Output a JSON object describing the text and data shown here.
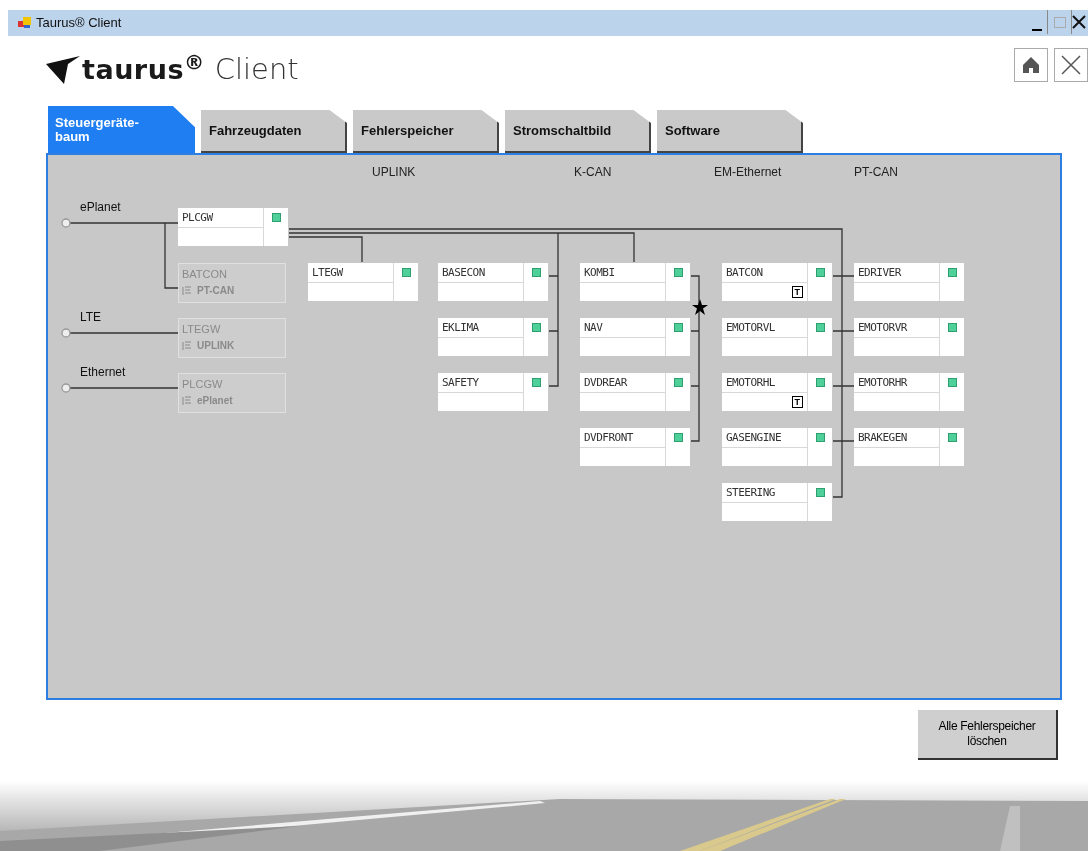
{
  "window": {
    "title": "Taurus® Client"
  },
  "logo": {
    "brand": "taurus$^{®}$",
    "product": "Client"
  },
  "tabs": [
    {
      "label": "Steuergeräte-\nbaum",
      "selected": true
    },
    {
      "label": "Fahrzeugdaten",
      "selected": false
    },
    {
      "label": "Fehlerspeicher",
      "selected": false
    },
    {
      "label": "Stromschaltbild",
      "selected": false
    },
    {
      "label": "Software",
      "selected": false
    }
  ],
  "buses": [
    "UPLINK",
    "K-CAN",
    "EM-Ethernet",
    "PT-CAN"
  ],
  "roots": [
    {
      "label": "ePlanet"
    },
    {
      "label": "LTE"
    },
    {
      "label": "Ethernet"
    }
  ],
  "nodes": [
    {
      "kind": "device",
      "name": "PLCGW",
      "online": true
    },
    {
      "kind": "ghost",
      "name": "BATCON",
      "bus": "PT-CAN"
    },
    {
      "kind": "ghost",
      "name": "LTEGW",
      "bus": "UPLINK"
    },
    {
      "kind": "ghost",
      "name": "PLCGW",
      "bus": "ePlanet"
    },
    {
      "kind": "device",
      "name": "LTEGW",
      "online": true
    },
    {
      "kind": "device",
      "name": "BASECON",
      "online": true
    },
    {
      "kind": "device",
      "name": "EKLIMA",
      "online": true
    },
    {
      "kind": "device",
      "name": "SAFETY",
      "online": true
    },
    {
      "kind": "device",
      "name": "KOMBI",
      "online": true
    },
    {
      "kind": "device",
      "name": "NAV",
      "online": true
    },
    {
      "kind": "device",
      "name": "DVDREAR",
      "online": true
    },
    {
      "kind": "device",
      "name": "DVDFRONT",
      "online": true
    },
    {
      "kind": "device",
      "name": "BATCON",
      "online": true,
      "badge": "T"
    },
    {
      "kind": "device",
      "name": "EMOTORVL",
      "online": true
    },
    {
      "kind": "device",
      "name": "EMOTORHL",
      "online": true,
      "badge": "T"
    },
    {
      "kind": "device",
      "name": "GASENGINE",
      "online": true
    },
    {
      "kind": "device",
      "name": "STEERING",
      "online": true
    },
    {
      "kind": "device",
      "name": "EDRIVER",
      "online": true
    },
    {
      "kind": "device",
      "name": "EMOTORVR",
      "online": true
    },
    {
      "kind": "device",
      "name": "EMOTORHR",
      "online": true
    },
    {
      "kind": "device",
      "name": "BRAKEGEN",
      "online": true
    }
  ],
  "action_button": "Alle Fehlerspeicher\nlöschen"
}
